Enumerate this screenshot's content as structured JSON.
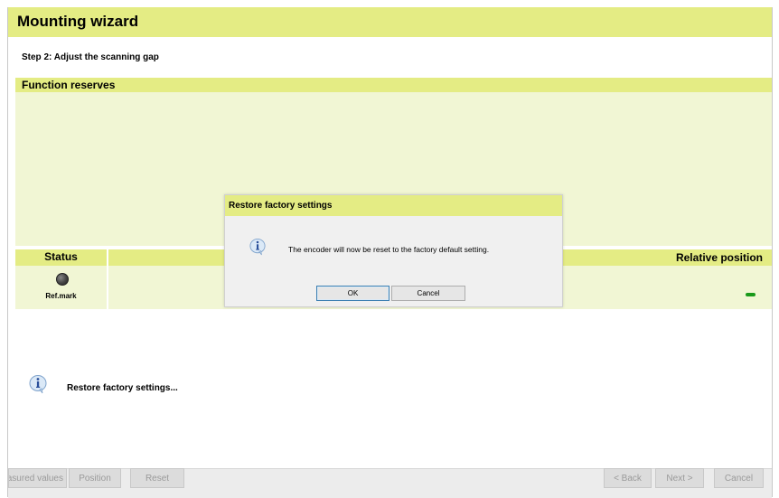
{
  "window": {
    "title": "Mounting wizard",
    "step": "Step 2: Adjust the scanning gap"
  },
  "function_reserves": {
    "header": "Function reserves"
  },
  "status_panel": {
    "status_label": "Status",
    "relative_position_label": "Relative position",
    "ref_mark_label": "Ref.mark"
  },
  "message": {
    "text": "Restore factory settings..."
  },
  "toolbar": {
    "measured_values": "Measured values",
    "position": "Position",
    "reset": "Reset",
    "back": "< Back",
    "next": "Next >",
    "cancel": "Cancel"
  },
  "dialog": {
    "title": "Restore factory settings",
    "message": "The encoder will now be reset to the factory default setting.",
    "ok": "OK",
    "cancel": "Cancel"
  },
  "colors": {
    "header_accent": "#e4ec84",
    "panel_fill": "#f1f6d4",
    "status_indicator_ok": "#1a9a1a"
  },
  "icons": {
    "info": "info-icon",
    "ref_mark_led": "status-led-icon"
  }
}
